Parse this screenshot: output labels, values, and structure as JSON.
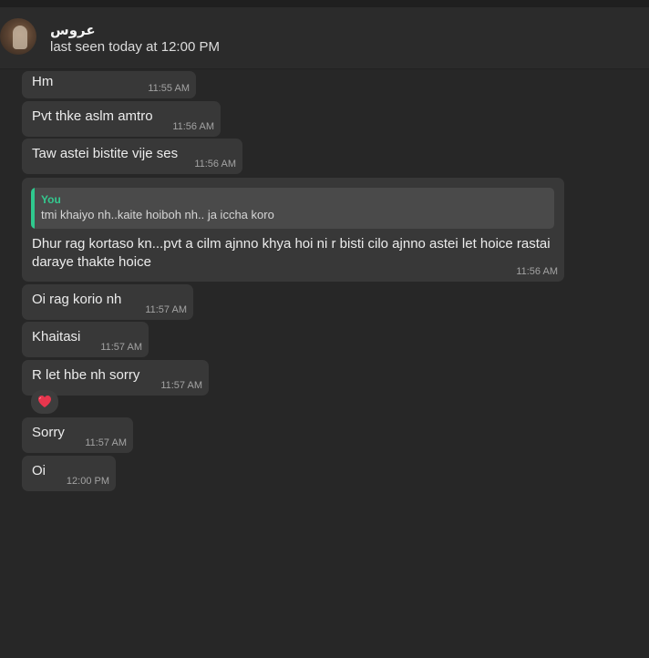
{
  "contact": {
    "name": "عروس",
    "status": "last seen today at 12:00 PM"
  },
  "messages": [
    {
      "text": "Hm",
      "time": "11:55 AM"
    },
    {
      "text": "Pvt thke aslm amtro",
      "time": "11:56 AM"
    },
    {
      "text": "Taw astei bistite vije ses",
      "time": "11:56 AM"
    },
    {
      "quote_author": "You",
      "quote_text": "tmi khaiyo nh..kaite hoiboh nh.. ja iccha koro",
      "text": "Dhur rag kortaso kn...pvt a cilm ajnno khya hoi ni r bisti cilo ajnno astei let hoice rastai daraye thakte hoice",
      "time": "11:56 AM"
    },
    {
      "text": "Oi rag korio nh",
      "time": "11:57 AM"
    },
    {
      "text": "Khaitasi",
      "time": "11:57 AM"
    },
    {
      "text": "R let hbe nh sorry",
      "time": "11:57 AM",
      "reaction": "red-heart-icon"
    },
    {
      "text": "Sorry",
      "time": "11:57 AM"
    },
    {
      "text": "Oi",
      "time": "12:00 PM"
    }
  ]
}
